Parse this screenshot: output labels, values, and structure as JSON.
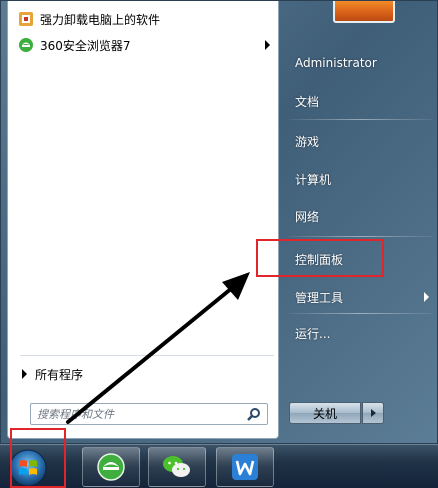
{
  "left_pane": {
    "programs": [
      {
        "label": "强力卸载电脑上的软件",
        "icon": "uninstall-app-icon",
        "has_submenu": false
      },
      {
        "label": "360安全浏览器7",
        "icon": "360-browser-icon",
        "has_submenu": true
      }
    ],
    "all_programs_label": "所有程序",
    "search_placeholder": "搜索程序和文件"
  },
  "right_pane": {
    "user_name": "Administrator",
    "items": [
      {
        "label": "文档",
        "has_submenu": false
      },
      {
        "label": "游戏",
        "has_submenu": false
      },
      {
        "label": "计算机",
        "has_submenu": false
      },
      {
        "label": "网络",
        "has_submenu": false
      },
      {
        "label": "控制面板",
        "has_submenu": false
      },
      {
        "label": "管理工具",
        "has_submenu": true
      },
      {
        "label": "运行...",
        "has_submenu": false
      }
    ],
    "shutdown_label": "关机"
  },
  "taskbar": {
    "buttons": [
      {
        "icon": "start-orb-icon"
      },
      {
        "icon": "360-browser-taskbar-icon"
      },
      {
        "icon": "wechat-icon"
      },
      {
        "icon": "wps-writer-icon"
      }
    ]
  },
  "colors": {
    "highlight_red": "#e0262b",
    "menu_glass": "#4a6a85",
    "taskbar": "#1f3246"
  }
}
